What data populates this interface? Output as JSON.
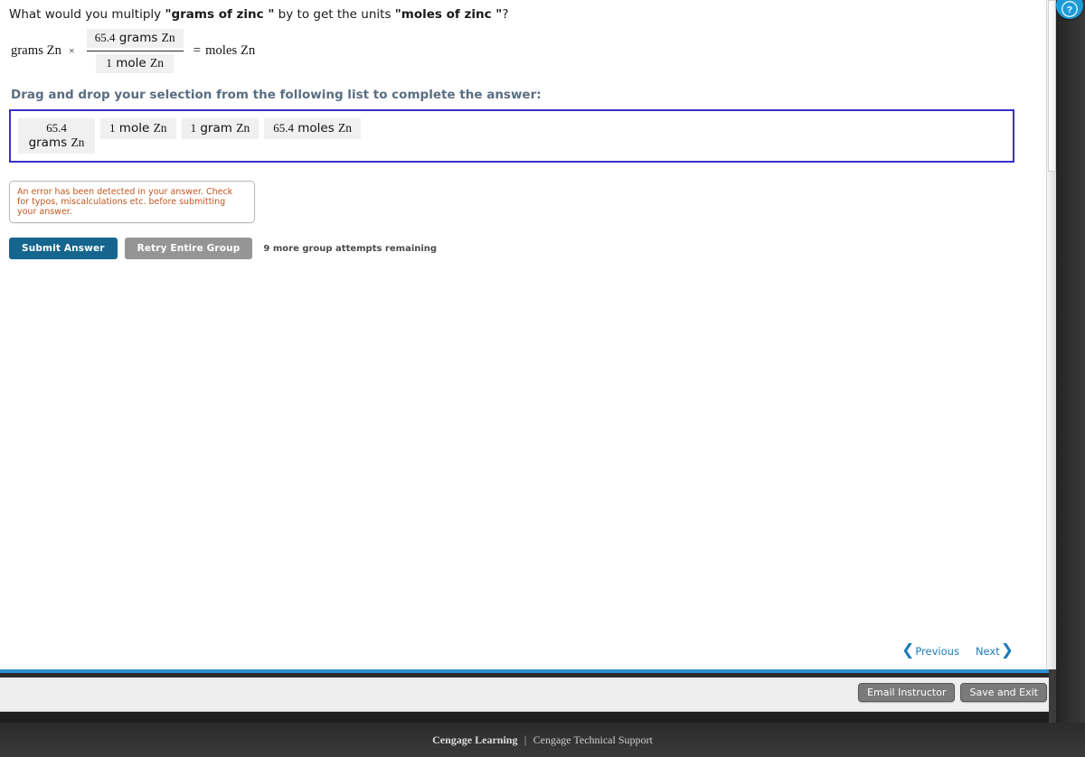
{
  "question": {
    "prefix": "What would you multiply ",
    "quantity_from": "\"grams of zinc \"",
    "middle": " by to get the units ",
    "quantity_to": "\"moles of zinc \"",
    "suffix": "?",
    "full_text": "What would you multiply \"grams of zinc \" by to get the units \"moles of zinc \"?"
  },
  "equation": {
    "left_term": "grams Zn",
    "multiply_symbol": "×",
    "numerator": {
      "number": "65.4",
      "unit": "grams",
      "element": "Zn",
      "filled": true
    },
    "denominator": {
      "number": "1",
      "unit": "mole",
      "element": "Zn",
      "filled": true
    },
    "equals_symbol": "=",
    "right_term": "moles Zn"
  },
  "dragdrop": {
    "heading": "Drag and drop your selection from the following list to complete the answer:",
    "border_color": "#3b2fc6",
    "tiles": [
      {
        "number": "65.4",
        "unit": "grams",
        "element": "Zn",
        "label": "65.4 grams Zn",
        "wraps": true
      },
      {
        "number": "1",
        "unit": "mole",
        "element": "Zn",
        "label": "1 mole Zn",
        "wraps": false
      },
      {
        "number": "1",
        "unit": "gram",
        "element": "Zn",
        "label": "1 gram Zn",
        "wraps": false
      },
      {
        "number": "65.4",
        "unit": "moles",
        "element": "Zn",
        "label": "65.4 moles Zn",
        "wraps": false
      }
    ]
  },
  "feedback": {
    "message": "An error has been detected in your answer. Check for typos, miscalculations etc. before submitting your answer.",
    "text_color": "#c2571e",
    "state": "error"
  },
  "actions": {
    "submit_label": "Submit Answer",
    "submit_color": "#15658f",
    "retry_label": "Retry Entire Group",
    "retry_color": "#959595",
    "attempts_text": "9 more group attempts remaining"
  },
  "navigation": {
    "previous_label": "Previous",
    "next_label": "Next",
    "previous_chevron": "❮",
    "next_chevron": "❯",
    "link_color": "#1d7bb9"
  },
  "footer": {
    "email_instructor_label": "Email Instructor",
    "save_and_exit_label": "Save and Exit",
    "accent_rule_color": "#2e8fd0"
  },
  "brand": {
    "primary": "Cengage Learning",
    "separator": "|",
    "secondary": "Cengage Technical Support"
  },
  "help": {
    "glyph": "?",
    "color": "#1d9bd7",
    "title": "Help"
  }
}
